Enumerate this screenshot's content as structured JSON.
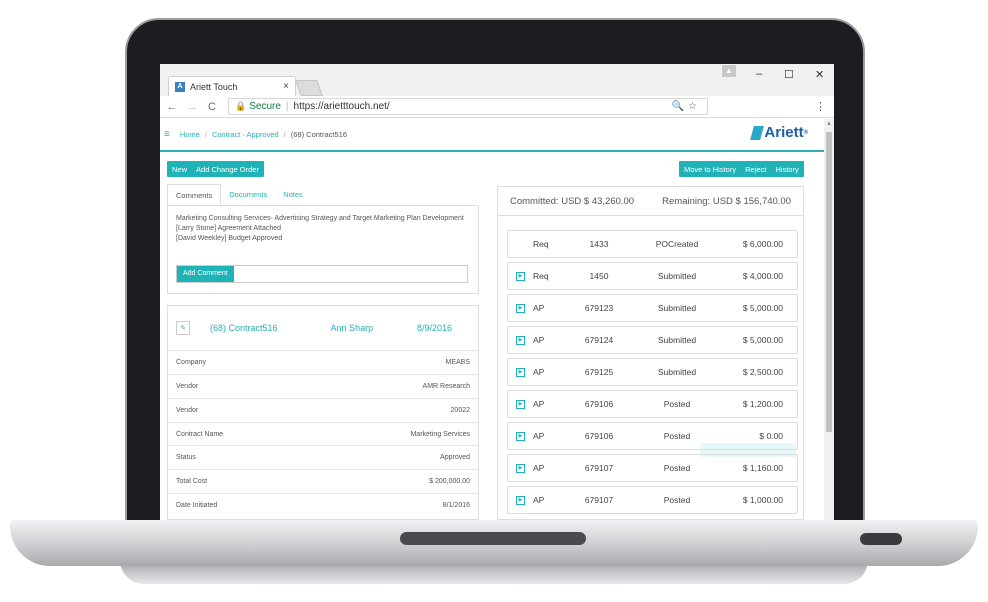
{
  "browser": {
    "tab_title": "Ariett Touch",
    "tab_close": "×",
    "win_min": "–",
    "win_max": "☐",
    "win_close": "✕",
    "back": "←",
    "forward": "→",
    "reload": "C",
    "secure_label": "Secure",
    "url": "https://arietttouch.net/",
    "omni_icons": "🔍☆",
    "menu": "⋮"
  },
  "app": {
    "breadcrumb": {
      "home": "Home",
      "level1": "Contract - Approved",
      "current": "(68) Contract516",
      "sep": "/"
    },
    "brand": "Ariett",
    "brand_sup": "®",
    "toolbar": {
      "new": "New",
      "add_change_order": "Add Change Order",
      "move_to_history": "Move to History",
      "reject": "Reject",
      "history": "History"
    },
    "tabs": {
      "comments": "Comments",
      "documents": "Documents",
      "notes": "Notes"
    },
    "comments": {
      "line1": "Marketing Consulting Services- Advertising Strategy and Target Marketing Plan Development",
      "line2": "[Larry Stone] Agreement Attached",
      "line3": "[David Weekley] Budget Approved",
      "add_comment": "Add Comment"
    },
    "detail_header": {
      "contract": "(68) Contract516",
      "owner": "Ann Sharp",
      "date": "8/9/2016"
    },
    "details": [
      {
        "label": "Company",
        "value": "MEABS"
      },
      {
        "label": "Vendor",
        "value": "AMR Research"
      },
      {
        "label": "Vendor",
        "value": "20022"
      },
      {
        "label": "Contract Name",
        "value": "Marketing Services"
      },
      {
        "label": "Status",
        "value": "Approved"
      },
      {
        "label": "Total Cost",
        "value": "$ 200,000.00"
      },
      {
        "label": "Date Initiated",
        "value": "8/1/2016"
      }
    ],
    "summary": {
      "committed": "Committed: USD $ 43,260.00",
      "remaining": "Remaining: USD $ 156,740.00"
    },
    "transactions": [
      {
        "type": "Req",
        "number": "1433",
        "status": "POCreated",
        "amount": "$ 6,000.00",
        "icon": false
      },
      {
        "type": "Req",
        "number": "1450",
        "status": "Submitted",
        "amount": "$ 4,000.00",
        "icon": true
      },
      {
        "type": "AP",
        "number": "679123",
        "status": "Submitted",
        "amount": "$ 5,000.00",
        "icon": true
      },
      {
        "type": "AP",
        "number": "679124",
        "status": "Submitted",
        "amount": "$ 5,000.00",
        "icon": true
      },
      {
        "type": "AP",
        "number": "679125",
        "status": "Submitted",
        "amount": "$ 2,500.00",
        "icon": true
      },
      {
        "type": "AP",
        "number": "679106",
        "status": "Posted",
        "amount": "$ 1,200.00",
        "icon": true
      },
      {
        "type": "AP",
        "number": "679106",
        "status": "Posted",
        "amount": "$ 0.00",
        "icon": true
      },
      {
        "type": "AP",
        "number": "679107",
        "status": "Posted",
        "amount": "$ 1,160.00",
        "icon": true
      },
      {
        "type": "AP",
        "number": "679107",
        "status": "Posted",
        "amount": "$ 1,000.00",
        "icon": true
      }
    ]
  }
}
